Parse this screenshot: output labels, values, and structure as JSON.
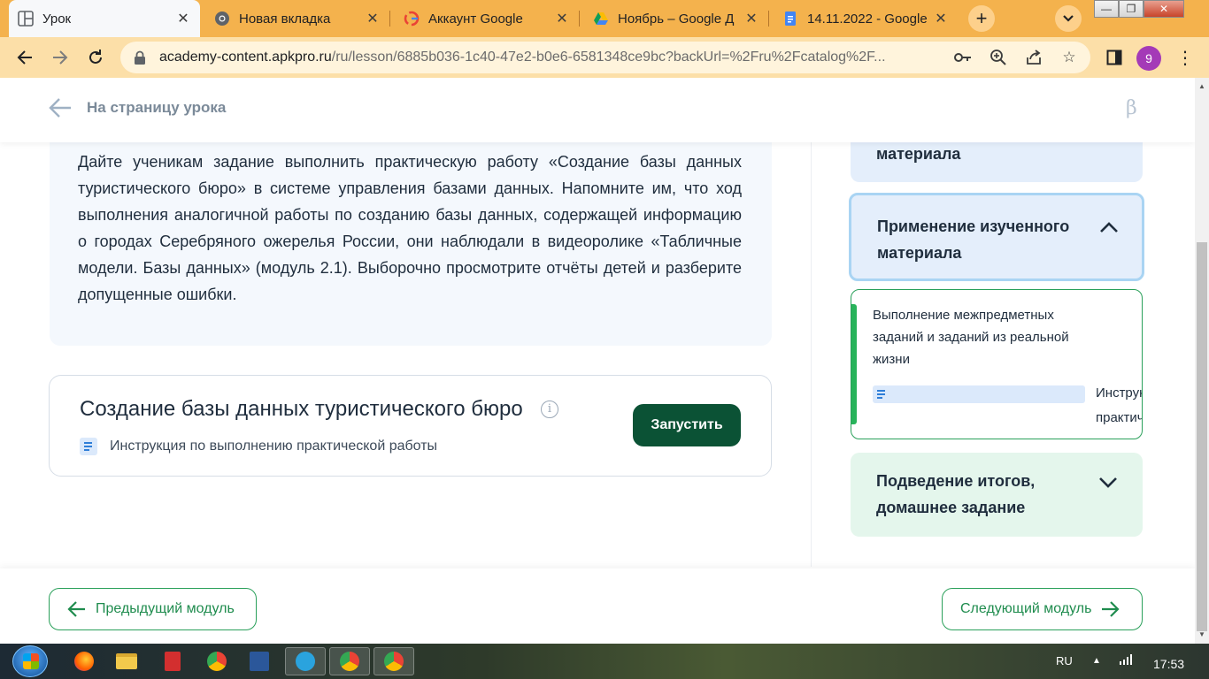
{
  "browser": {
    "tabs": [
      {
        "label": "Урок",
        "icon": "layout-icon",
        "active": true
      },
      {
        "label": "Новая вкладка",
        "icon": "chrome-icon",
        "active": false
      },
      {
        "label": "Аккаунт Google",
        "icon": "google-icon",
        "active": false
      },
      {
        "label": "Ноябрь – Google Д",
        "icon": "google-drive-icon",
        "active": false
      },
      {
        "label": "14.11.2022 - Google",
        "icon": "google-docs-icon",
        "active": false
      }
    ],
    "url_host": "academy-content.apkpro.ru",
    "url_path": "/ru/lesson/6885b036-1c40-47e2-b0e6-6581348ce9bc?backUrl=%2Fru%2Fcatalog%2F...",
    "profile_initial": "9",
    "colors": {
      "tabbar": "#f4b24d",
      "toolbar": "#fcdfa8",
      "profile": "#a43ab7"
    }
  },
  "header": {
    "back_label": "На страницу урока",
    "beta_mark": "β"
  },
  "content": {
    "instruction": "Дайте ученикам задание выполнить практическую работу «Создание базы данных туристического бюро» в системе управления базами данных. Напомните им, что ход выполнения аналогичной работы по созданию базы данных, содержащей информацию о городах Серебряного ожерелья России, они наблюдали в видеоролике «Табличные модели. Базы данных» (модуль 2.1). Выборочно просмотрите отчёты детей и разберите допущенные ошибки.",
    "task": {
      "title": "Создание базы данных туристического бюро",
      "info_glyph": "i",
      "instruction_label": "Инструкция по выполнению практической работы",
      "run_label": "Запустить"
    }
  },
  "sidebar": {
    "prev_section_label": "материала",
    "active_section_label": "Применение изученного материала",
    "active_item": {
      "title": "Выполнение межпредметных заданий и заданий из реальной жизни",
      "doc_label": "Инструкция по выполнению практической работы"
    },
    "next_section_label": "Подведение итогов, домашнее задание"
  },
  "footer": {
    "prev_label": "Предыдущий модуль",
    "next_label": "Следующий модуль"
  },
  "taskbar": {
    "language": "RU",
    "time": "17:53",
    "apps": [
      "firefox-icon",
      "file-explorer-icon",
      "pdf-icon",
      "chrome-icon",
      "word-icon",
      "telegram-icon",
      "chrome-icon",
      "chrome-icon"
    ]
  },
  "theme": {
    "accent_green": "#0b5235",
    "border_green": "#2aa05a",
    "light_blue": "#e4eefb",
    "light_green": "#e4f6ec"
  }
}
